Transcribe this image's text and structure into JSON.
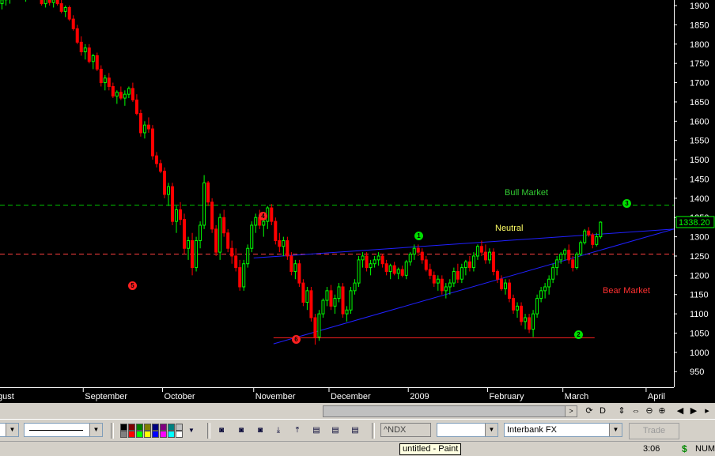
{
  "chart_data": {
    "type": "candlestick",
    "symbol": "^NDX",
    "last_price": "1338.20",
    "ylim": [
      930,
      1935
    ],
    "y_ticks": [
      1900,
      1850,
      1800,
      1750,
      1700,
      1650,
      1600,
      1550,
      1500,
      1450,
      1400,
      1350,
      1300,
      1250,
      1200,
      1150,
      1100,
      1050,
      1000,
      950
    ],
    "x_labels": [
      "gust",
      "September",
      "October",
      "November",
      "December",
      "2009",
      "February",
      "March",
      "April"
    ],
    "bars_in_view": 170,
    "month_starts": [
      -1,
      21,
      41,
      64,
      83,
      103,
      123,
      142,
      163
    ],
    "candles": [
      {
        "o": 1905,
        "h": 1935,
        "l": 1890,
        "c": 1915
      },
      {
        "o": 1915,
        "h": 1930,
        "l": 1900,
        "c": 1920
      },
      {
        "o": 1920,
        "h": 1935,
        "l": 1905,
        "c": 1925
      },
      {
        "o": 1925,
        "h": 1935,
        "l": 1915,
        "c": 1930
      },
      {
        "o": 1930,
        "h": 1935,
        "l": 1920,
        "c": 1928
      },
      {
        "o": 1928,
        "h": 1935,
        "l": 1915,
        "c": 1925
      },
      {
        "o": 1925,
        "h": 1935,
        "l": 1910,
        "c": 1930
      },
      {
        "o": 1930,
        "h": 1935,
        "l": 1918,
        "c": 1922
      },
      {
        "o": 1922,
        "h": 1935,
        "l": 1915,
        "c": 1932
      },
      {
        "o": 1932,
        "h": 1935,
        "l": 1918,
        "c": 1920
      },
      {
        "o": 1920,
        "h": 1930,
        "l": 1900,
        "c": 1905
      },
      {
        "o": 1905,
        "h": 1925,
        "l": 1895,
        "c": 1918
      },
      {
        "o": 1918,
        "h": 1925,
        "l": 1900,
        "c": 1908
      },
      {
        "o": 1908,
        "h": 1920,
        "l": 1895,
        "c": 1915
      },
      {
        "o": 1915,
        "h": 1925,
        "l": 1900,
        "c": 1905
      },
      {
        "o": 1905,
        "h": 1915,
        "l": 1880,
        "c": 1885
      },
      {
        "o": 1885,
        "h": 1900,
        "l": 1870,
        "c": 1895
      },
      {
        "o": 1895,
        "h": 1900,
        "l": 1860,
        "c": 1865
      },
      {
        "o": 1865,
        "h": 1875,
        "l": 1835,
        "c": 1840
      },
      {
        "o": 1840,
        "h": 1850,
        "l": 1800,
        "c": 1805
      },
      {
        "o": 1805,
        "h": 1820,
        "l": 1770,
        "c": 1780
      },
      {
        "o": 1780,
        "h": 1800,
        "l": 1760,
        "c": 1790
      },
      {
        "o": 1790,
        "h": 1800,
        "l": 1750,
        "c": 1755
      },
      {
        "o": 1755,
        "h": 1775,
        "l": 1735,
        "c": 1770
      },
      {
        "o": 1770,
        "h": 1778,
        "l": 1730,
        "c": 1735
      },
      {
        "o": 1735,
        "h": 1745,
        "l": 1690,
        "c": 1700
      },
      {
        "o": 1700,
        "h": 1720,
        "l": 1680,
        "c": 1712
      },
      {
        "o": 1712,
        "h": 1725,
        "l": 1680,
        "c": 1690
      },
      {
        "o": 1690,
        "h": 1700,
        "l": 1660,
        "c": 1665
      },
      {
        "o": 1665,
        "h": 1680,
        "l": 1645,
        "c": 1675
      },
      {
        "o": 1675,
        "h": 1690,
        "l": 1655,
        "c": 1660
      },
      {
        "o": 1660,
        "h": 1680,
        "l": 1640,
        "c": 1670
      },
      {
        "o": 1670,
        "h": 1690,
        "l": 1660,
        "c": 1685
      },
      {
        "o": 1685,
        "h": 1700,
        "l": 1650,
        "c": 1655
      },
      {
        "o": 1655,
        "h": 1670,
        "l": 1615,
        "c": 1620
      },
      {
        "o": 1620,
        "h": 1630,
        "l": 1560,
        "c": 1570
      },
      {
        "o": 1570,
        "h": 1600,
        "l": 1555,
        "c": 1590
      },
      {
        "o": 1590,
        "h": 1610,
        "l": 1570,
        "c": 1580
      },
      {
        "o": 1580,
        "h": 1590,
        "l": 1500,
        "c": 1510
      },
      {
        "o": 1510,
        "h": 1520,
        "l": 1480,
        "c": 1490
      },
      {
        "o": 1490,
        "h": 1500,
        "l": 1465,
        "c": 1470
      },
      {
        "o": 1470,
        "h": 1480,
        "l": 1400,
        "c": 1410
      },
      {
        "o": 1410,
        "h": 1440,
        "l": 1380,
        "c": 1430
      },
      {
        "o": 1430,
        "h": 1440,
        "l": 1330,
        "c": 1340
      },
      {
        "o": 1340,
        "h": 1380,
        "l": 1310,
        "c": 1370
      },
      {
        "o": 1370,
        "h": 1390,
        "l": 1330,
        "c": 1345
      },
      {
        "o": 1345,
        "h": 1360,
        "l": 1255,
        "c": 1270
      },
      {
        "o": 1270,
        "h": 1300,
        "l": 1240,
        "c": 1290
      },
      {
        "o": 1290,
        "h": 1310,
        "l": 1200,
        "c": 1220
      },
      {
        "o": 1220,
        "h": 1300,
        "l": 1210,
        "c": 1290
      },
      {
        "o": 1290,
        "h": 1340,
        "l": 1270,
        "c": 1330
      },
      {
        "o": 1330,
        "h": 1460,
        "l": 1320,
        "c": 1440
      },
      {
        "o": 1440,
        "h": 1445,
        "l": 1380,
        "c": 1390
      },
      {
        "o": 1390,
        "h": 1400,
        "l": 1310,
        "c": 1320
      },
      {
        "o": 1320,
        "h": 1330,
        "l": 1250,
        "c": 1260
      },
      {
        "o": 1260,
        "h": 1360,
        "l": 1240,
        "c": 1350
      },
      {
        "o": 1350,
        "h": 1370,
        "l": 1300,
        "c": 1310
      },
      {
        "o": 1310,
        "h": 1320,
        "l": 1260,
        "c": 1270
      },
      {
        "o": 1270,
        "h": 1290,
        "l": 1230,
        "c": 1250
      },
      {
        "o": 1250,
        "h": 1270,
        "l": 1210,
        "c": 1220
      },
      {
        "o": 1220,
        "h": 1240,
        "l": 1160,
        "c": 1170
      },
      {
        "o": 1170,
        "h": 1240,
        "l": 1160,
        "c": 1230
      },
      {
        "o": 1230,
        "h": 1280,
        "l": 1220,
        "c": 1270
      },
      {
        "o": 1270,
        "h": 1340,
        "l": 1260,
        "c": 1330
      },
      {
        "o": 1330,
        "h": 1360,
        "l": 1310,
        "c": 1350
      },
      {
        "o": 1350,
        "h": 1370,
        "l": 1320,
        "c": 1330
      },
      {
        "o": 1330,
        "h": 1350,
        "l": 1300,
        "c": 1340
      },
      {
        "o": 1340,
        "h": 1380,
        "l": 1320,
        "c": 1375
      },
      {
        "o": 1375,
        "h": 1385,
        "l": 1330,
        "c": 1340
      },
      {
        "o": 1340,
        "h": 1350,
        "l": 1280,
        "c": 1290
      },
      {
        "o": 1290,
        "h": 1310,
        "l": 1260,
        "c": 1275
      },
      {
        "o": 1275,
        "h": 1300,
        "l": 1250,
        "c": 1290
      },
      {
        "o": 1290,
        "h": 1300,
        "l": 1240,
        "c": 1250
      },
      {
        "o": 1250,
        "h": 1260,
        "l": 1200,
        "c": 1210
      },
      {
        "o": 1210,
        "h": 1240,
        "l": 1190,
        "c": 1230
      },
      {
        "o": 1230,
        "h": 1240,
        "l": 1170,
        "c": 1180
      },
      {
        "o": 1180,
        "h": 1190,
        "l": 1120,
        "c": 1130
      },
      {
        "o": 1130,
        "h": 1170,
        "l": 1110,
        "c": 1160
      },
      {
        "o": 1160,
        "h": 1170,
        "l": 1080,
        "c": 1090
      },
      {
        "o": 1090,
        "h": 1100,
        "l": 1020,
        "c": 1040
      },
      {
        "o": 1040,
        "h": 1110,
        "l": 1030,
        "c": 1100
      },
      {
        "o": 1100,
        "h": 1140,
        "l": 1090,
        "c": 1135
      },
      {
        "o": 1135,
        "h": 1170,
        "l": 1120,
        "c": 1160
      },
      {
        "o": 1160,
        "h": 1175,
        "l": 1110,
        "c": 1120
      },
      {
        "o": 1120,
        "h": 1150,
        "l": 1100,
        "c": 1140
      },
      {
        "o": 1140,
        "h": 1180,
        "l": 1130,
        "c": 1170
      },
      {
        "o": 1170,
        "h": 1180,
        "l": 1090,
        "c": 1100
      },
      {
        "o": 1100,
        "h": 1120,
        "l": 1080,
        "c": 1110
      },
      {
        "o": 1110,
        "h": 1170,
        "l": 1100,
        "c": 1160
      },
      {
        "o": 1160,
        "h": 1190,
        "l": 1150,
        "c": 1180
      },
      {
        "o": 1180,
        "h": 1250,
        "l": 1170,
        "c": 1240
      },
      {
        "o": 1240,
        "h": 1260,
        "l": 1220,
        "c": 1250
      },
      {
        "o": 1250,
        "h": 1260,
        "l": 1210,
        "c": 1220
      },
      {
        "o": 1220,
        "h": 1240,
        "l": 1200,
        "c": 1230
      },
      {
        "o": 1230,
        "h": 1250,
        "l": 1220,
        "c": 1240
      },
      {
        "o": 1240,
        "h": 1260,
        "l": 1225,
        "c": 1250
      },
      {
        "o": 1250,
        "h": 1255,
        "l": 1220,
        "c": 1230
      },
      {
        "o": 1230,
        "h": 1240,
        "l": 1200,
        "c": 1210
      },
      {
        "o": 1210,
        "h": 1230,
        "l": 1190,
        "c": 1225
      },
      {
        "o": 1225,
        "h": 1235,
        "l": 1200,
        "c": 1205
      },
      {
        "o": 1205,
        "h": 1220,
        "l": 1190,
        "c": 1215
      },
      {
        "o": 1215,
        "h": 1225,
        "l": 1195,
        "c": 1200
      },
      {
        "o": 1200,
        "h": 1240,
        "l": 1190,
        "c": 1235
      },
      {
        "o": 1235,
        "h": 1260,
        "l": 1225,
        "c": 1255
      },
      {
        "o": 1255,
        "h": 1280,
        "l": 1240,
        "c": 1270
      },
      {
        "o": 1270,
        "h": 1280,
        "l": 1250,
        "c": 1260
      },
      {
        "o": 1260,
        "h": 1270,
        "l": 1230,
        "c": 1240
      },
      {
        "o": 1240,
        "h": 1250,
        "l": 1210,
        "c": 1215
      },
      {
        "o": 1215,
        "h": 1230,
        "l": 1190,
        "c": 1200
      },
      {
        "o": 1200,
        "h": 1210,
        "l": 1170,
        "c": 1180
      },
      {
        "o": 1180,
        "h": 1200,
        "l": 1160,
        "c": 1190
      },
      {
        "o": 1190,
        "h": 1200,
        "l": 1150,
        "c": 1160
      },
      {
        "o": 1160,
        "h": 1180,
        "l": 1140,
        "c": 1170
      },
      {
        "o": 1170,
        "h": 1190,
        "l": 1150,
        "c": 1180
      },
      {
        "o": 1180,
        "h": 1220,
        "l": 1170,
        "c": 1210
      },
      {
        "o": 1210,
        "h": 1230,
        "l": 1180,
        "c": 1190
      },
      {
        "o": 1190,
        "h": 1230,
        "l": 1180,
        "c": 1220
      },
      {
        "o": 1220,
        "h": 1240,
        "l": 1200,
        "c": 1235
      },
      {
        "o": 1235,
        "h": 1250,
        "l": 1210,
        "c": 1220
      },
      {
        "o": 1220,
        "h": 1260,
        "l": 1210,
        "c": 1250
      },
      {
        "o": 1250,
        "h": 1280,
        "l": 1240,
        "c": 1275
      },
      {
        "o": 1275,
        "h": 1290,
        "l": 1250,
        "c": 1260
      },
      {
        "o": 1260,
        "h": 1280,
        "l": 1230,
        "c": 1240
      },
      {
        "o": 1240,
        "h": 1270,
        "l": 1230,
        "c": 1260
      },
      {
        "o": 1260,
        "h": 1270,
        "l": 1200,
        "c": 1210
      },
      {
        "o": 1210,
        "h": 1215,
        "l": 1180,
        "c": 1190
      },
      {
        "o": 1190,
        "h": 1200,
        "l": 1160,
        "c": 1165
      },
      {
        "o": 1165,
        "h": 1190,
        "l": 1150,
        "c": 1180
      },
      {
        "o": 1180,
        "h": 1190,
        "l": 1130,
        "c": 1140
      },
      {
        "o": 1140,
        "h": 1150,
        "l": 1100,
        "c": 1110
      },
      {
        "o": 1110,
        "h": 1130,
        "l": 1090,
        "c": 1120
      },
      {
        "o": 1120,
        "h": 1130,
        "l": 1070,
        "c": 1080
      },
      {
        "o": 1080,
        "h": 1100,
        "l": 1060,
        "c": 1090
      },
      {
        "o": 1090,
        "h": 1100,
        "l": 1050,
        "c": 1060
      },
      {
        "o": 1060,
        "h": 1110,
        "l": 1040,
        "c": 1100
      },
      {
        "o": 1100,
        "h": 1150,
        "l": 1090,
        "c": 1140
      },
      {
        "o": 1140,
        "h": 1170,
        "l": 1130,
        "c": 1160
      },
      {
        "o": 1160,
        "h": 1180,
        "l": 1140,
        "c": 1170
      },
      {
        "o": 1170,
        "h": 1200,
        "l": 1150,
        "c": 1190
      },
      {
        "o": 1190,
        "h": 1230,
        "l": 1180,
        "c": 1220
      },
      {
        "o": 1220,
        "h": 1250,
        "l": 1200,
        "c": 1240
      },
      {
        "o": 1240,
        "h": 1260,
        "l": 1230,
        "c": 1255
      },
      {
        "o": 1255,
        "h": 1270,
        "l": 1240,
        "c": 1265
      },
      {
        "o": 1265,
        "h": 1280,
        "l": 1230,
        "c": 1240
      },
      {
        "o": 1240,
        "h": 1250,
        "l": 1210,
        "c": 1220
      },
      {
        "o": 1220,
        "h": 1260,
        "l": 1215,
        "c": 1255
      },
      {
        "o": 1255,
        "h": 1290,
        "l": 1250,
        "c": 1285
      },
      {
        "o": 1285,
        "h": 1320,
        "l": 1280,
        "c": 1315
      },
      {
        "o": 1315,
        "h": 1325,
        "l": 1300,
        "c": 1305
      },
      {
        "o": 1305,
        "h": 1310,
        "l": 1270,
        "c": 1280
      },
      {
        "o": 1280,
        "h": 1310,
        "l": 1275,
        "c": 1300
      },
      {
        "o": 1300,
        "h": 1340,
        "l": 1295,
        "c": 1338
      }
    ],
    "lines": [
      {
        "name": "bull-market-line",
        "y": 1382,
        "x0": 0,
        "x1": 170,
        "color": "#00c800",
        "style": "dash"
      },
      {
        "name": "bear-market-line",
        "y": 1255,
        "x0": 0,
        "x1": 170,
        "color": "#ff4040",
        "style": "dash"
      },
      {
        "name": "support-line",
        "y": 1038,
        "x0": 69,
        "x1": 150,
        "color": "#ff2020",
        "style": "solid"
      },
      {
        "name": "upper-trendline",
        "x0": 64,
        "y0": 1245,
        "x1": 170,
        "y1": 1320,
        "color": "#2020ff",
        "style": "solid"
      },
      {
        "name": "lower-trendline",
        "x0": 69,
        "y0": 1022,
        "x1": 170,
        "y1": 1320,
        "color": "#2020ff",
        "style": "solid"
      }
    ],
    "annotations": {
      "bull_market": "Bull Market",
      "neutral": "Neutral",
      "bear_market": "Bear Market"
    },
    "markers": [
      {
        "label": "1",
        "color": "#00e000"
      },
      {
        "label": "2",
        "color": "#00e000"
      },
      {
        "label": "3",
        "color": "#00e000"
      },
      {
        "label": "4",
        "color": "#ff2020"
      },
      {
        "label": "5",
        "color": "#ff2020"
      },
      {
        "label": "6",
        "color": "#ff2020"
      }
    ],
    "colors": {
      "up": "#00ff00",
      "down": "#ff0000",
      "background": "#000000",
      "axis_text": "#ffffff"
    }
  },
  "toolbar": {
    "symbol_field": "^NDX",
    "provider": "Interbank FX",
    "trade_label": "Trade",
    "nav_glyphs": [
      "$",
      "D",
      "⇕",
      "⇔",
      "⊖",
      "⊕",
      "◀",
      "▶",
      "▸"
    ]
  },
  "status": {
    "tooltip": "untitled - Paint",
    "time": "3:06",
    "currency": "$",
    "numlock": "NUM"
  }
}
